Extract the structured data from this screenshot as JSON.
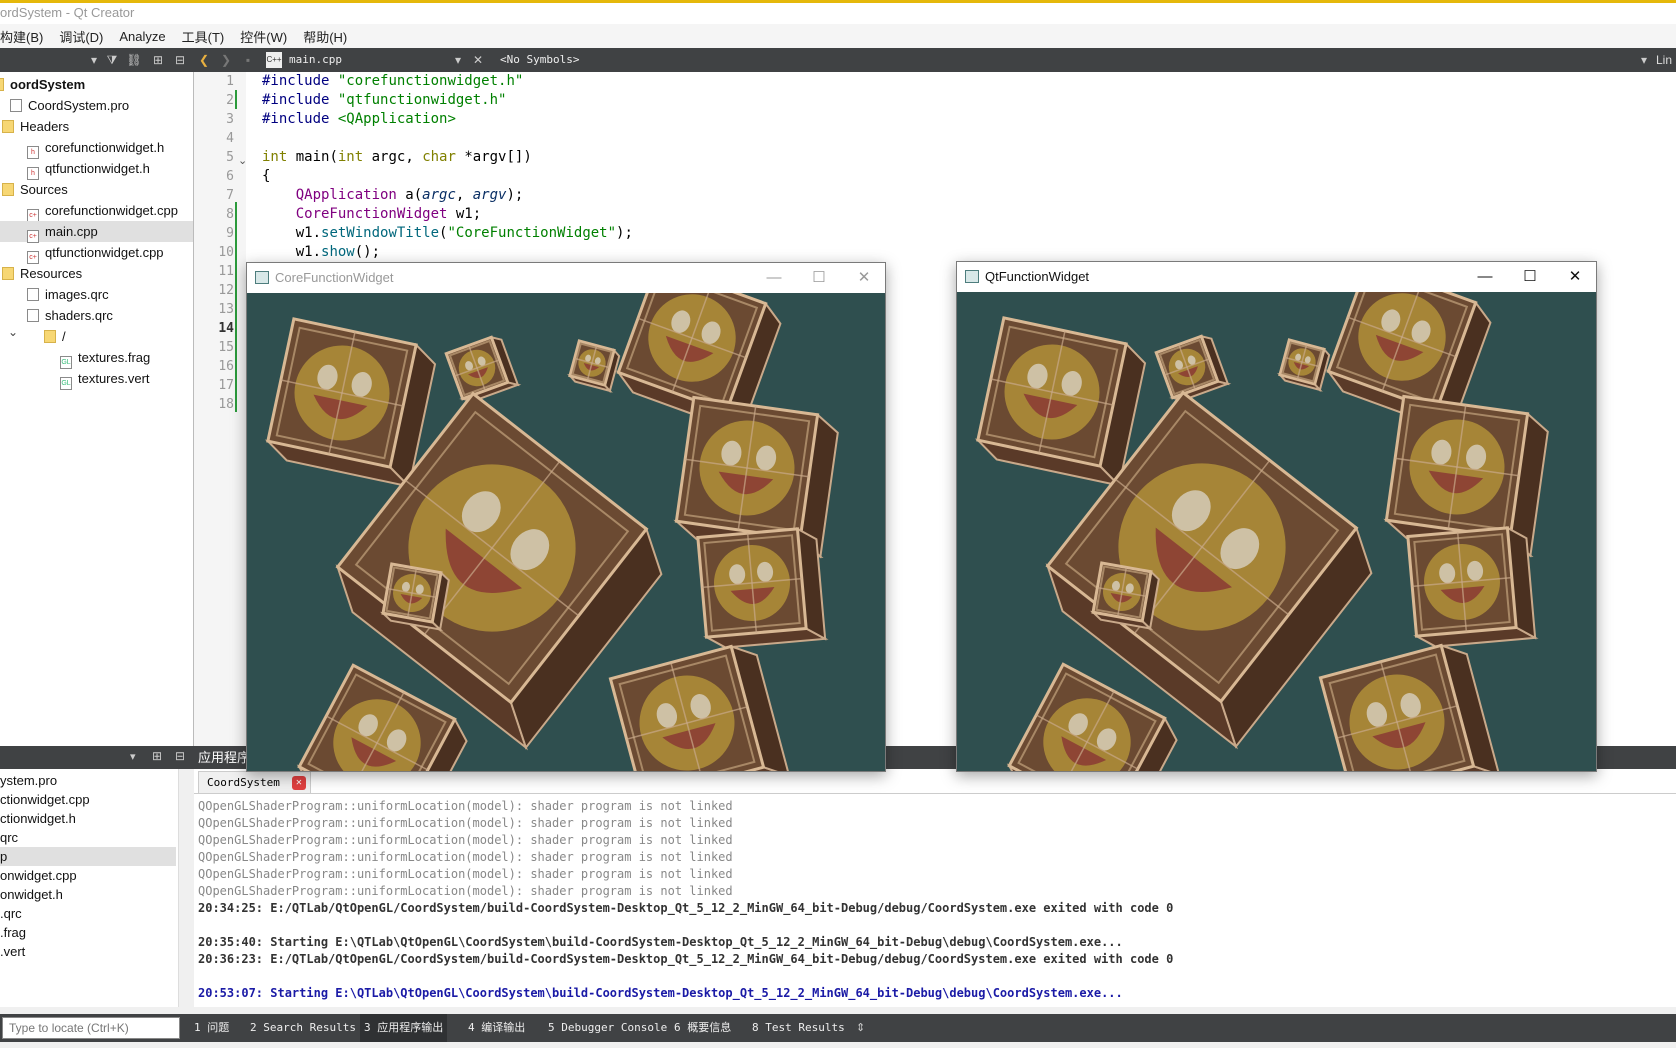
{
  "title": "ordSystem - Qt Creator",
  "menu": [
    "构建(B)",
    "调试(D)",
    "Analyze",
    "工具(T)",
    "控件(W)",
    "帮助(H)"
  ],
  "toolbar": {
    "file": "main.cpp",
    "symbols": "<No Symbols>",
    "right_cut": "Lin"
  },
  "tree": [
    {
      "label": "oordSystem",
      "indent": 0,
      "icon": "folder",
      "bold": true
    },
    {
      "label": "CoordSystem.pro",
      "indent": 10,
      "icon": "pro"
    },
    {
      "label": "Headers",
      "indent": 10,
      "icon": "folder"
    },
    {
      "label": "corefunctionwidget.h",
      "indent": 27,
      "icon": "h"
    },
    {
      "label": "qtfunctionwidget.h",
      "indent": 27,
      "icon": "h"
    },
    {
      "label": "Sources",
      "indent": 10,
      "icon": "folder"
    },
    {
      "label": "corefunctionwidget.cpp",
      "indent": 27,
      "icon": "cpp"
    },
    {
      "label": "main.cpp",
      "indent": 27,
      "icon": "cpp",
      "selected": true
    },
    {
      "label": "qtfunctionwidget.cpp",
      "indent": 27,
      "icon": "cpp"
    },
    {
      "label": "Resources",
      "indent": 10,
      "icon": "folder"
    },
    {
      "label": "images.qrc",
      "indent": 27,
      "icon": "qrc"
    },
    {
      "label": "shaders.qrc",
      "indent": 27,
      "icon": "qrc"
    },
    {
      "label": "/",
      "indent": 44,
      "icon": "folder"
    },
    {
      "label": "textures.frag",
      "indent": 60,
      "icon": "gl"
    },
    {
      "label": "textures.vert",
      "indent": 60,
      "icon": "gl"
    }
  ],
  "line_numbers": [
    "1",
    "2",
    "3",
    "4",
    "5",
    "6",
    "7",
    "8",
    "9",
    "10",
    "11",
    "12",
    "13",
    "14",
    "15",
    "16",
    "17",
    "18"
  ],
  "current_line": "14",
  "open_docs": [
    "ystem.pro",
    "ctionwidget.cpp",
    "ctionwidget.h",
    "qrc",
    "p",
    "onwidget.cpp",
    "onwidget.h",
    ".qrc",
    ".frag",
    ".vert"
  ],
  "output_pane": {
    "header": "应用程序",
    "tab": "CoordSystem"
  },
  "output_lines": [
    {
      "text": "QOpenGLShaderProgram::uniformLocation(model): shader program is not linked",
      "style": "gray"
    },
    {
      "text": "QOpenGLShaderProgram::uniformLocation(model): shader program is not linked",
      "style": "gray"
    },
    {
      "text": "QOpenGLShaderProgram::uniformLocation(model): shader program is not linked",
      "style": "gray"
    },
    {
      "text": "QOpenGLShaderProgram::uniformLocation(model): shader program is not linked",
      "style": "gray"
    },
    {
      "text": "QOpenGLShaderProgram::uniformLocation(model): shader program is not linked",
      "style": "gray"
    },
    {
      "text": "QOpenGLShaderProgram::uniformLocation(model): shader program is not linked",
      "style": "gray"
    },
    {
      "text": "20:34:25: E:/QTLab/QtOpenGL/CoordSystem/build-CoordSystem-Desktop_Qt_5_12_2_MinGW_64_bit-Debug/debug/CoordSystem.exe exited with code 0",
      "style": "dark"
    },
    {
      "text": "",
      "style": "dark"
    },
    {
      "text": "20:35:40: Starting E:\\QTLab\\QtOpenGL\\CoordSystem\\build-CoordSystem-Desktop_Qt_5_12_2_MinGW_64_bit-Debug\\debug\\CoordSystem.exe...",
      "style": "dark"
    },
    {
      "text": "20:36:23: E:/QTLab/QtOpenGL/CoordSystem/build-CoordSystem-Desktop_Qt_5_12_2_MinGW_64_bit-Debug/debug/CoordSystem.exe exited with code 0",
      "style": "dark"
    },
    {
      "text": "",
      "style": "dark"
    },
    {
      "text": "20:53:07: Starting E:\\QTLab\\QtOpenGL\\CoordSystem\\build-CoordSystem-Desktop_Qt_5_12_2_MinGW_64_bit-Debug\\debug\\CoordSystem.exe...",
      "style": "blue"
    }
  ],
  "status": {
    "locate_placeholder": "Type to locate (Ctrl+K)",
    "tabs": [
      "1 问题",
      "2 Search Results",
      "3 应用程序输出",
      "4 编译输出",
      "5 Debugger Console",
      "6 概要信息",
      "8 Test Results"
    ],
    "active_tab": 2
  },
  "windows": {
    "core": {
      "title": "CoreFunctionWidget",
      "active": false
    },
    "qt": {
      "title": "QtFunctionWidget",
      "active": true
    }
  },
  "colors": {
    "gl_clear": "#2f4f4f",
    "dark_panel": "#404244",
    "mod_marker": "#2b9a3b"
  }
}
